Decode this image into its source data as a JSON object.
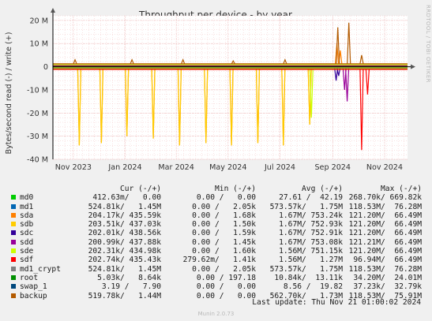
{
  "chart_data": {
    "type": "line",
    "title": "Throughput per device - by year",
    "ylabel": "Bytes/second read (-) / write (+)",
    "credit": "RRDTOOL / TOBI OETIKER",
    "ylim": [
      -40000000,
      22000000
    ],
    "yticks": [
      {
        "value": 20000000,
        "label": "20 M"
      },
      {
        "value": 10000000,
        "label": "10 M"
      },
      {
        "value": 0,
        "label": "0"
      },
      {
        "value": -10000000,
        "label": "-10 M"
      },
      {
        "value": -20000000,
        "label": "-20 M"
      },
      {
        "value": -30000000,
        "label": "-30 M"
      },
      {
        "value": -40000000,
        "label": "-40 M"
      }
    ],
    "xrange": [
      "2023-10-08",
      "2024-11-28"
    ],
    "xticks": [
      {
        "date": "2023-11-01",
        "label": "Nov 2023"
      },
      {
        "date": "2024-01-01",
        "label": "Jan 2024"
      },
      {
        "date": "2024-03-01",
        "label": "Mar 2024"
      },
      {
        "date": "2024-05-01",
        "label": "May 2024"
      },
      {
        "date": "2024-07-01",
        "label": "Jul 2024"
      },
      {
        "date": "2024-09-01",
        "label": "Sep 2024"
      },
      {
        "date": "2024-11-01",
        "label": "Nov 2024"
      }
    ],
    "series": [
      {
        "name": "md0",
        "color": "#00cc00",
        "base": [
          0.2,
          -0.2
        ],
        "spikes": []
      },
      {
        "name": "md1",
        "color": "#0066b3",
        "base": [
          0.3,
          -0.7
        ],
        "spikes": []
      },
      {
        "name": "sda",
        "color": "#ff8000",
        "base": [
          1.0,
          -0.6
        ],
        "spikes": [
          {
            "date": "2023-11-08",
            "value": -34
          },
          {
            "date": "2023-12-04",
            "value": -33
          },
          {
            "date": "2024-01-03",
            "value": -30
          },
          {
            "date": "2024-02-03",
            "value": -31
          },
          {
            "date": "2024-03-05",
            "value": -34
          },
          {
            "date": "2024-04-05",
            "value": -33
          },
          {
            "date": "2024-05-05",
            "value": -34
          },
          {
            "date": "2024-06-05",
            "value": -33
          },
          {
            "date": "2024-07-05",
            "value": -34
          },
          {
            "date": "2024-08-05",
            "value": -25
          },
          {
            "date": "2024-09-06",
            "value": 10
          },
          {
            "date": "2024-09-10",
            "value": 7
          }
        ]
      },
      {
        "name": "sdb",
        "color": "#ffcc00",
        "base": [
          1.0,
          -0.6
        ],
        "spikes": [
          {
            "date": "2023-11-08",
            "value": -34
          },
          {
            "date": "2023-12-04",
            "value": -33
          },
          {
            "date": "2024-01-03",
            "value": -30
          },
          {
            "date": "2024-02-03",
            "value": -31
          },
          {
            "date": "2024-03-05",
            "value": -34
          },
          {
            "date": "2024-04-05",
            "value": -33
          },
          {
            "date": "2024-05-05",
            "value": -34
          },
          {
            "date": "2024-06-05",
            "value": -33
          },
          {
            "date": "2024-07-05",
            "value": -34
          },
          {
            "date": "2024-08-05",
            "value": -25
          }
        ]
      },
      {
        "name": "sdc",
        "color": "#330099",
        "base": [
          0.2,
          -0.3
        ],
        "spikes": [
          {
            "date": "2024-09-05",
            "value": -6
          },
          {
            "date": "2024-09-08",
            "value": -4
          }
        ]
      },
      {
        "name": "sdd",
        "color": "#990099",
        "base": [
          0.2,
          -0.3
        ],
        "spikes": [
          {
            "date": "2024-09-18",
            "value": -15
          },
          {
            "date": "2024-09-15",
            "value": -10
          }
        ]
      },
      {
        "name": "sde",
        "color": "#ccff00",
        "base": [
          0.8,
          -0.4
        ],
        "spikes": [
          {
            "date": "2024-08-07",
            "value": -22
          }
        ]
      },
      {
        "name": "sdf",
        "color": "#ff0000",
        "base": [
          0.4,
          -1.2
        ],
        "spikes": [
          {
            "date": "2024-10-05",
            "value": -36
          },
          {
            "date": "2024-10-12",
            "value": -12
          }
        ]
      },
      {
        "name": "md1_crypt",
        "color": "#808080",
        "base": [
          0.6,
          -0.8
        ],
        "spikes": []
      },
      {
        "name": "root",
        "color": "#008f00",
        "base": [
          0.05,
          -0.05
        ],
        "spikes": []
      },
      {
        "name": "swap_1",
        "color": "#00487d",
        "base": [
          0.0,
          -0.0
        ],
        "spikes": []
      },
      {
        "name": "backup",
        "color": "#b35a00",
        "base": [
          1.3,
          -0.9
        ],
        "spikes": [
          {
            "date": "2023-11-03",
            "value": 3
          },
          {
            "date": "2024-01-09",
            "value": 3
          },
          {
            "date": "2024-03-09",
            "value": 3
          },
          {
            "date": "2024-05-07",
            "value": 2.5
          },
          {
            "date": "2024-07-07",
            "value": 3
          },
          {
            "date": "2024-09-07",
            "value": 17
          },
          {
            "date": "2024-09-20",
            "value": 19
          },
          {
            "date": "2024-10-05",
            "value": 5
          }
        ]
      }
    ]
  },
  "legend": {
    "header": {
      "cur": "Cur (-/+)",
      "min": "Min (-/+)",
      "avg": "Avg (-/+)",
      "max": "Max (-/+)"
    },
    "rows": [
      {
        "name": "md0",
        "color": "#00cc00",
        "cur": "412.63m/   0.00",
        "min": "0.00 /   0.00",
        "avg": "27.61 /  42.19",
        "max": "268.70k/ 669.82k"
      },
      {
        "name": "md1",
        "color": "#0066b3",
        "cur": "524.81k/   1.45M",
        "min": "0.00 /   2.05k",
        "avg": "573.57k/   1.75M",
        "max": "118.53M/  76.28M"
      },
      {
        "name": "sda",
        "color": "#ff8000",
        "cur": "204.17k/ 435.59k",
        "min": "0.00 /   1.68k",
        "avg": "1.67M/ 753.24k",
        "max": "121.20M/  66.49M"
      },
      {
        "name": "sdb",
        "color": "#ffcc00",
        "cur": "203.51k/ 437.03k",
        "min": "0.00 /   1.50k",
        "avg": "1.67M/ 752.93k",
        "max": "121.20M/  66.49M"
      },
      {
        "name": "sdc",
        "color": "#330099",
        "cur": "202.01k/ 438.56k",
        "min": "0.00 /   1.59k",
        "avg": "1.67M/ 752.91k",
        "max": "121.20M/  66.49M"
      },
      {
        "name": "sdd",
        "color": "#990099",
        "cur": "200.99k/ 437.88k",
        "min": "0.00 /   1.45k",
        "avg": "1.67M/ 753.08k",
        "max": "121.21M/  66.49M"
      },
      {
        "name": "sde",
        "color": "#ccff00",
        "cur": "202.31k/ 434.98k",
        "min": "0.00 /   1.60k",
        "avg": "1.56M/ 751.15k",
        "max": "121.20M/  66.49M"
      },
      {
        "name": "sdf",
        "color": "#ff0000",
        "cur": "202.74k/ 435.43k",
        "min": "279.62m/   1.41k",
        "avg": "1.56M/   1.27M",
        "max": "96.94M/  66.49M"
      },
      {
        "name": "md1_crypt",
        "color": "#808080",
        "cur": "524.81k/   1.45M",
        "min": "0.00 /   2.05k",
        "avg": "573.57k/   1.75M",
        "max": "118.53M/  76.28M"
      },
      {
        "name": "root",
        "color": "#008f00",
        "cur": "5.03k/   8.64k",
        "min": "0.00 / 197.18",
        "avg": "10.84k/  13.11k",
        "max": "34.20M/  24.01M"
      },
      {
        "name": "swap_1",
        "color": "#00487d",
        "cur": "3.19 /   7.90",
        "min": "0.00 /   0.00",
        "avg": "8.56 /  19.82",
        "max": "37.23k/  32.79k"
      },
      {
        "name": "backup",
        "color": "#b35a00",
        "cur": "519.78k/   1.44M",
        "min": "0.00 /   0.00",
        "avg": "562.70k/   1.73M",
        "max": "118.53M/  75.91M"
      }
    ]
  },
  "last_update": "Last update: Thu Nov 21 01:00:02 2024",
  "footer": "Munin 2.0.73"
}
